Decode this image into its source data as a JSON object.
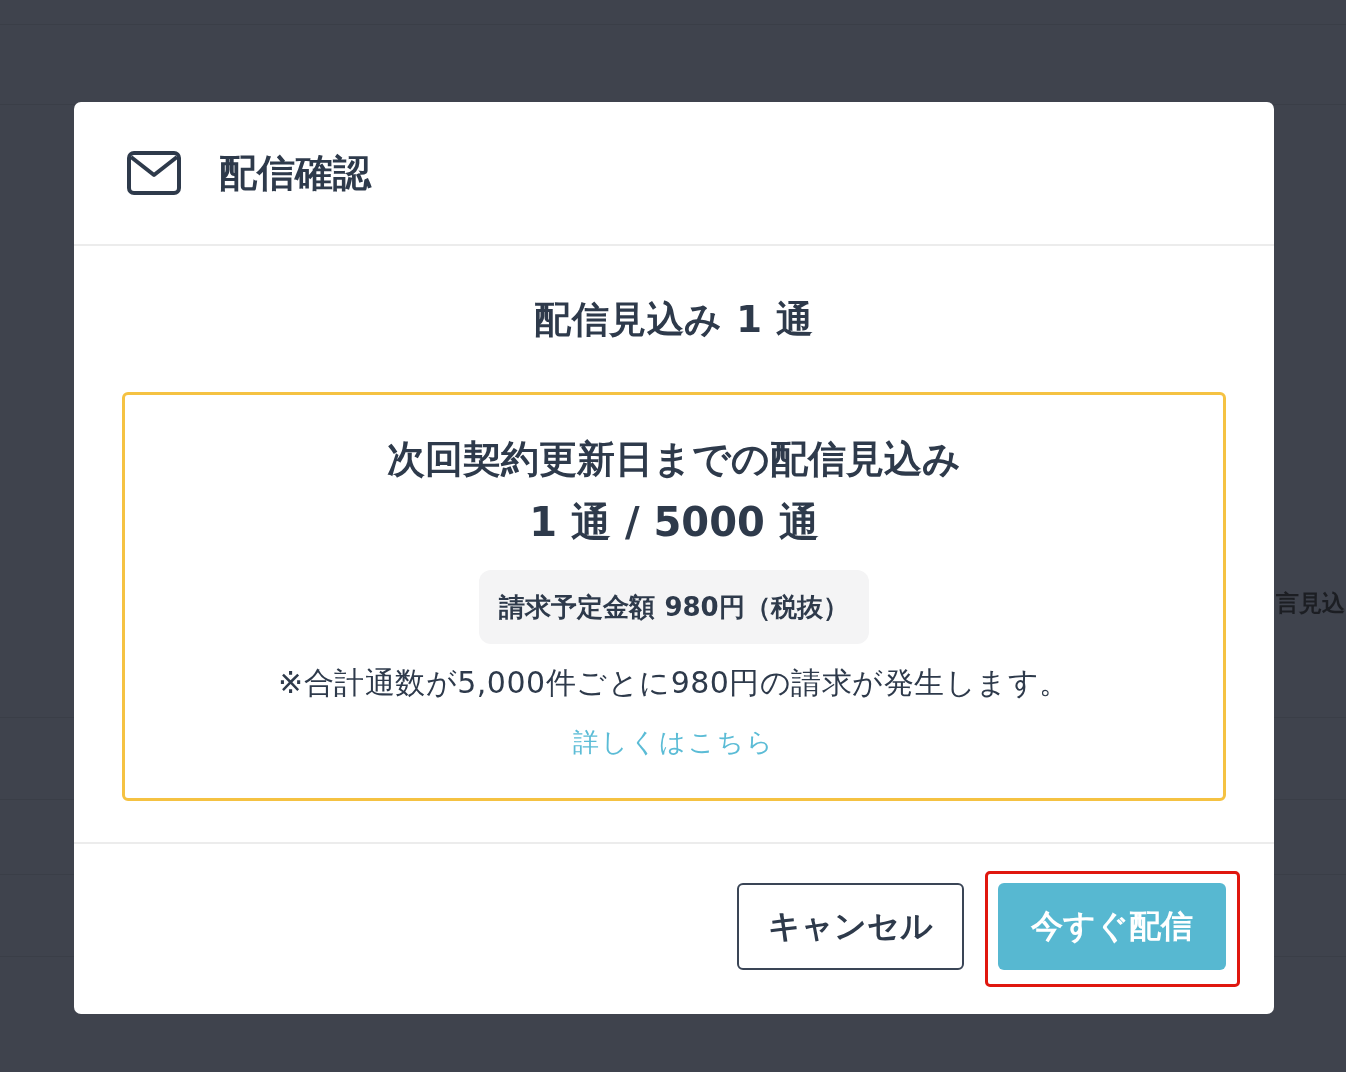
{
  "background": {
    "text": "言見込"
  },
  "dialog": {
    "title": "配信確認",
    "headline": "配信見込み 1 通",
    "notice": {
      "heading": "次回契約更新日までの配信見込み",
      "count": "1 通 / 5000 通",
      "amount": "請求予定金額 980円（税抜）",
      "note": "※合計通数が5,000件ごとに980円の請求が発生します。",
      "link": "詳しくはこちら"
    },
    "buttons": [
      {
        "label": "キャンセル",
        "kind": "secondary",
        "highlighted": false
      },
      {
        "label": "今すぐ配信",
        "kind": "primary",
        "highlighted": true
      }
    ]
  }
}
